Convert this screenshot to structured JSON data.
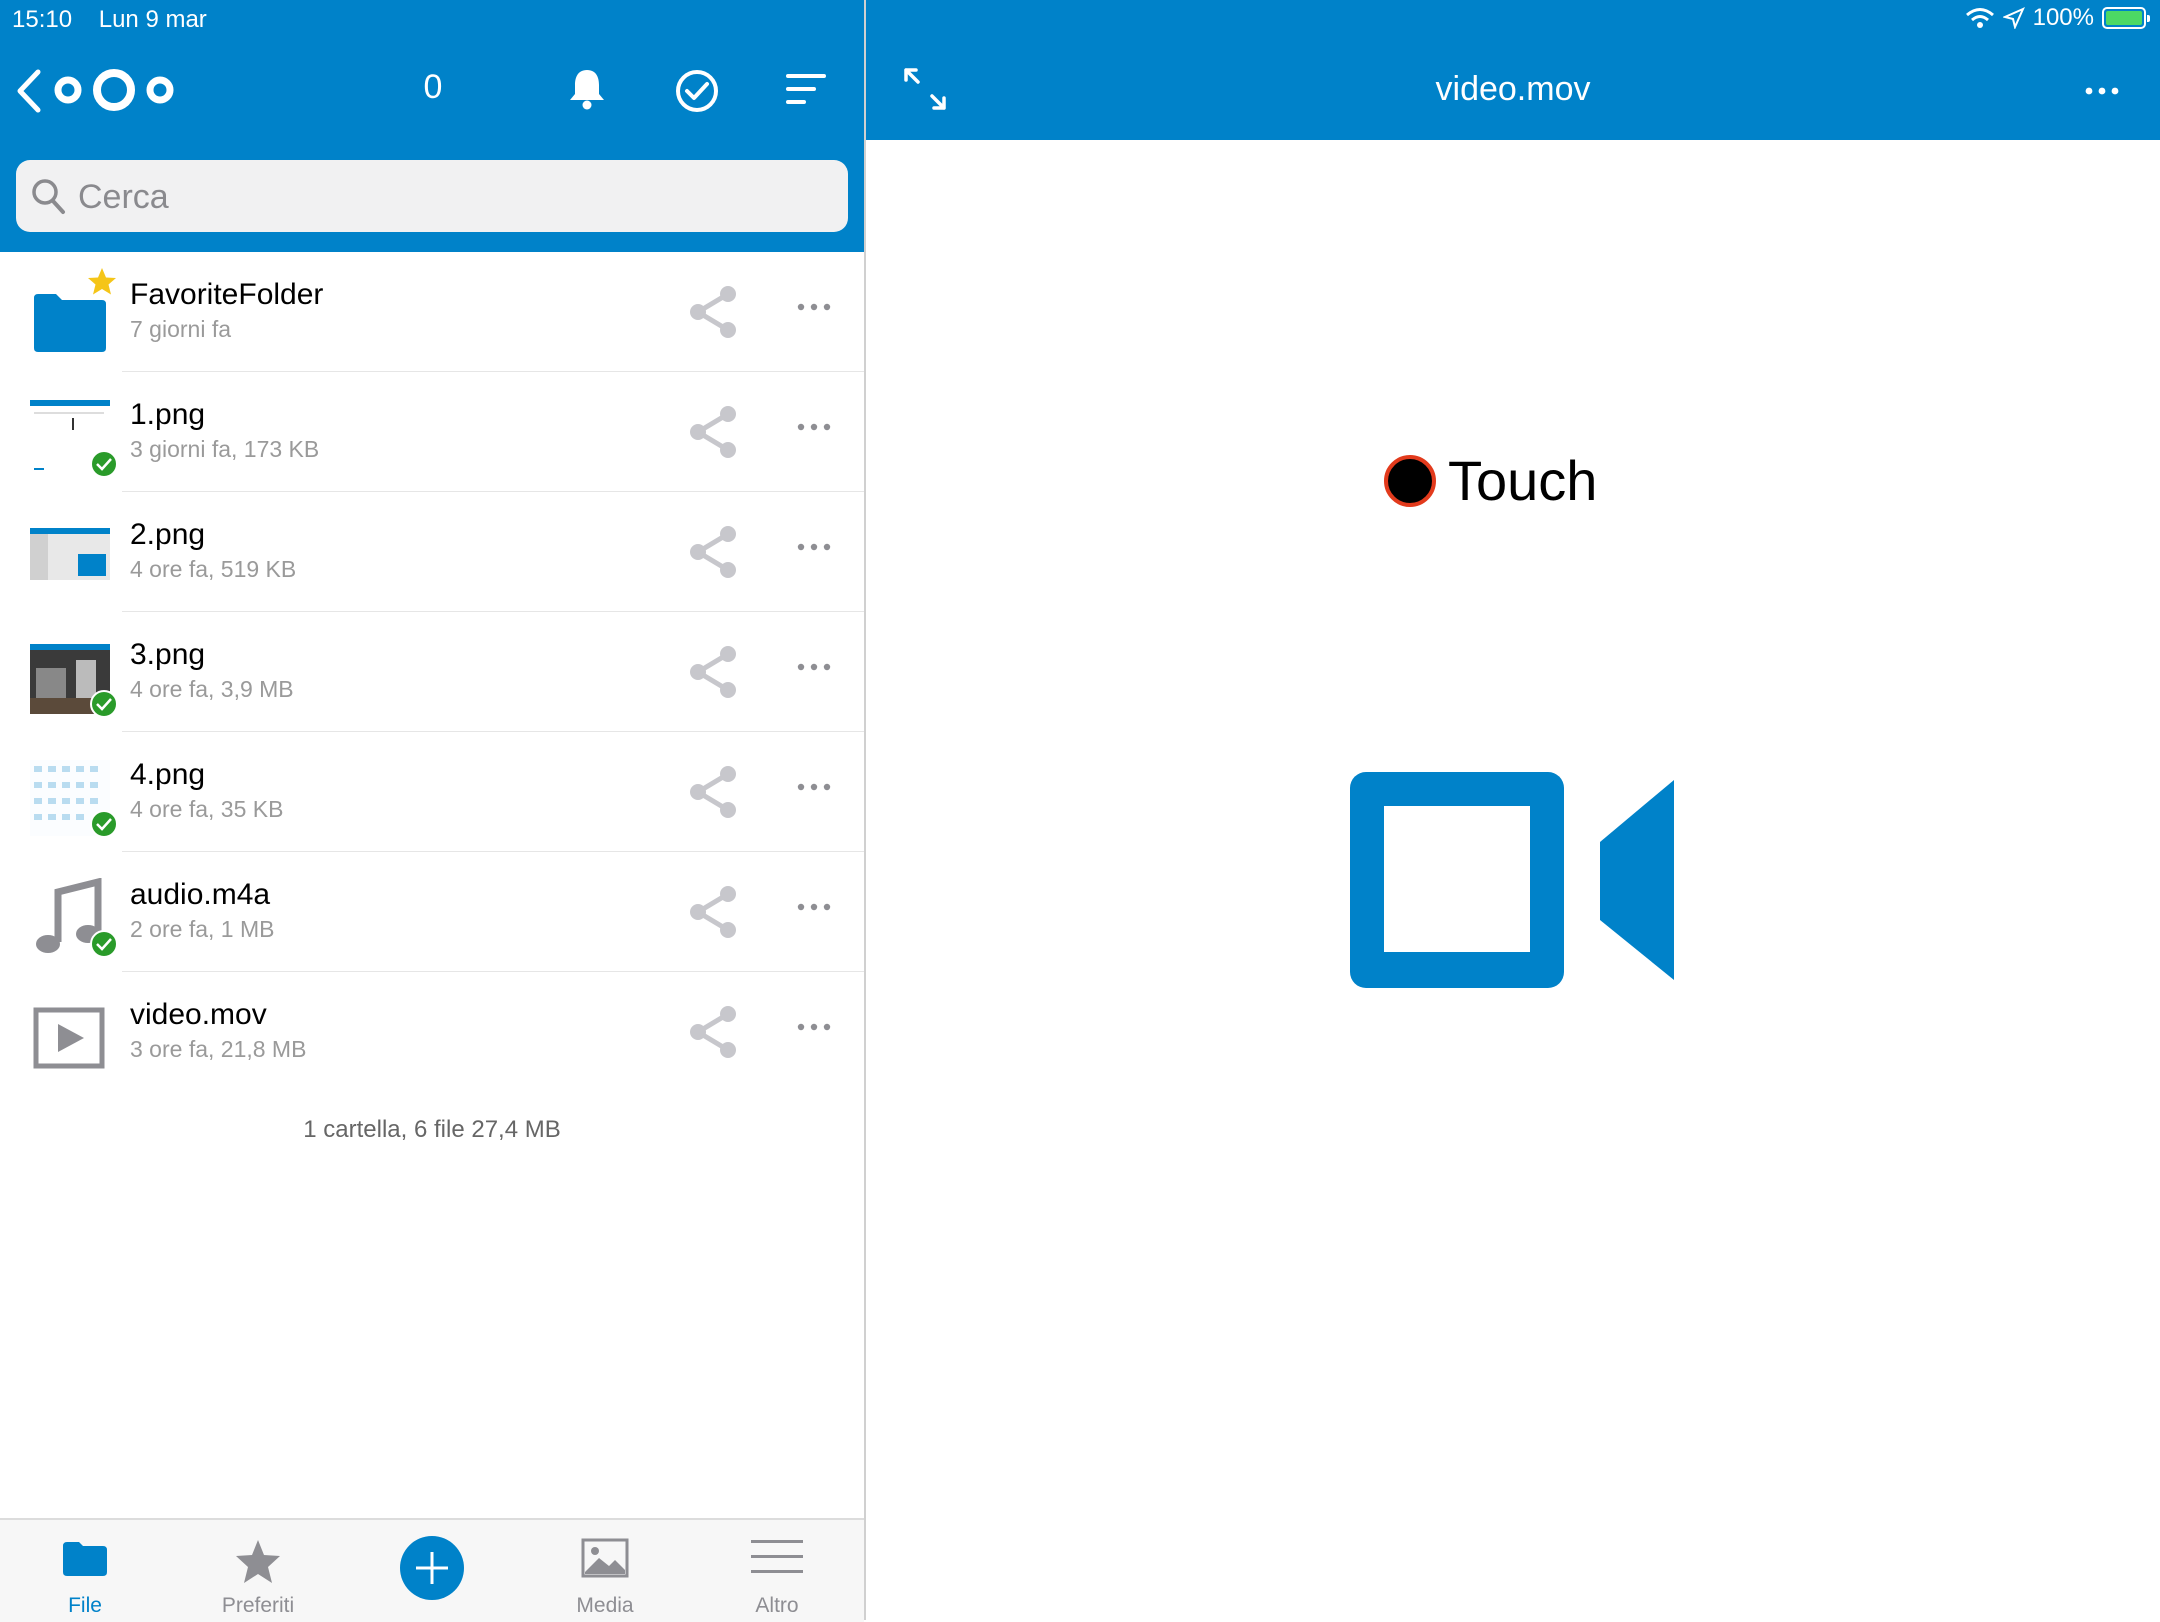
{
  "status_bar": {
    "time": "15:10",
    "date": "Lun 9 mar",
    "battery": "100%",
    "battery_level": 1.0
  },
  "header": {
    "app": "Nextcloud",
    "back_icon": "chevron-left-icon",
    "logo": "nextcloud-logo",
    "count": "0",
    "icons": [
      "bell-icon",
      "check-circle-icon",
      "sort-icon"
    ]
  },
  "search": {
    "placeholder": "Cerca"
  },
  "files": [
    {
      "name": "FavoriteFolder",
      "meta": "7 giorni fa",
      "type": "folder",
      "favorite": true,
      "synced": false
    },
    {
      "name": "1.png",
      "meta": "3 giorni fa, 173 KB",
      "type": "image",
      "synced": true
    },
    {
      "name": "2.png",
      "meta": "4 ore fa, 519 KB",
      "type": "image",
      "synced": false
    },
    {
      "name": "3.png",
      "meta": "4 ore fa, 3,9 MB",
      "type": "image",
      "synced": true
    },
    {
      "name": "4.png",
      "meta": "4 ore fa, 35 KB",
      "type": "image",
      "synced": true
    },
    {
      "name": "audio.m4a",
      "meta": "2 ore fa, 1 MB",
      "type": "audio",
      "synced": true
    },
    {
      "name": "video.mov",
      "meta": "3 ore fa, 21,8 MB",
      "type": "video",
      "synced": false
    }
  ],
  "summary": "1 cartella, 6 file 27,4 MB",
  "tabs": [
    {
      "label": "File",
      "icon": "folder-icon",
      "active": true
    },
    {
      "label": "Preferiti",
      "icon": "star-icon",
      "active": false
    },
    {
      "label": "",
      "icon": "plus-icon",
      "active": false
    },
    {
      "label": "Media",
      "icon": "image-icon",
      "active": false
    },
    {
      "label": "Altro",
      "icon": "menu-icon",
      "active": false
    }
  ],
  "viewer": {
    "title": "video.mov",
    "touch_label": "Touch",
    "icons": [
      "expand-icon",
      "more-icon",
      "video-camera-icon"
    ]
  },
  "colors": {
    "brand": "#0082c9",
    "synced": "#2a9b2a",
    "favorite": "#f5c518",
    "touch_ring": "#e23a1c"
  }
}
